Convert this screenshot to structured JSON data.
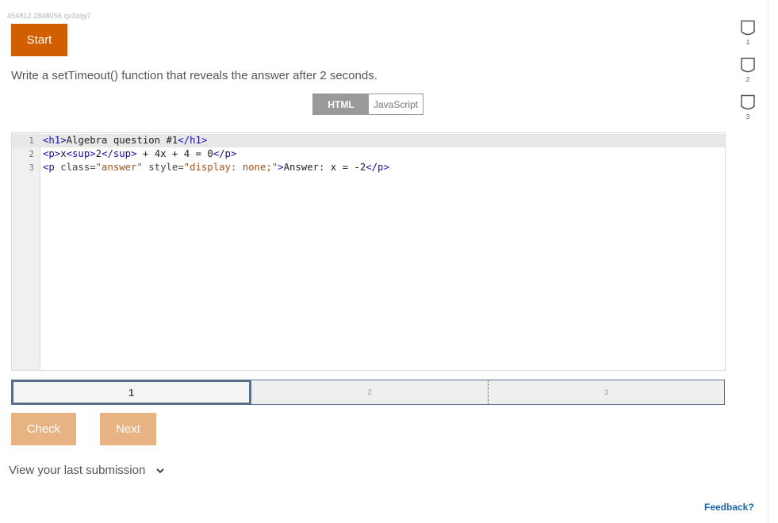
{
  "activity_id": "454812.2848056.qx3zqy7",
  "start_label": "Start",
  "prompt": "Write a setTimeout() function that reveals the answer after 2 seconds.",
  "tabs": {
    "html": "HTML",
    "javascript": "JavaScript",
    "active": "HTML"
  },
  "editor": {
    "line_numbers": [
      "1",
      "2",
      "3"
    ],
    "lines": [
      [
        {
          "t": "<h1>",
          "c": "tag"
        },
        {
          "t": "Algebra question #1",
          "c": "text"
        },
        {
          "t": "</h1>",
          "c": "tag"
        }
      ],
      [
        {
          "t": "<p>",
          "c": "tag"
        },
        {
          "t": "x",
          "c": "text"
        },
        {
          "t": "<sup>",
          "c": "tag"
        },
        {
          "t": "2",
          "c": "text"
        },
        {
          "t": "</sup>",
          "c": "tag"
        },
        {
          "t": " + 4x + 4 = 0",
          "c": "text"
        },
        {
          "t": "</p>",
          "c": "tag"
        }
      ],
      [
        {
          "t": "<p ",
          "c": "tag"
        },
        {
          "t": "class=",
          "c": "attr"
        },
        {
          "t": "\"answer\"",
          "c": "str"
        },
        {
          "t": " style=",
          "c": "attr"
        },
        {
          "t": "\"display: none;\"",
          "c": "str"
        },
        {
          "t": ">",
          "c": "tag"
        },
        {
          "t": "Answer: x = -2",
          "c": "text"
        },
        {
          "t": "</p>",
          "c": "tag"
        }
      ]
    ]
  },
  "steps": [
    "1",
    "2",
    "3"
  ],
  "active_step": "1",
  "check_label": "Check",
  "next_label": "Next",
  "last_submission_label": "View your last submission",
  "feedback_label": "Feedback?",
  "levels": [
    "1",
    "2",
    "3"
  ],
  "colors": {
    "start_button": "#d15f00",
    "action_buttons": "#e8b382",
    "step_border": "#5a6e8c",
    "feedback_link": "#1b65ad",
    "html_tag": "#170ca6",
    "string": "#a0521a"
  },
  "icons": {
    "levels": "level-badge-icon",
    "last_submission": "chevron-down-icon"
  }
}
